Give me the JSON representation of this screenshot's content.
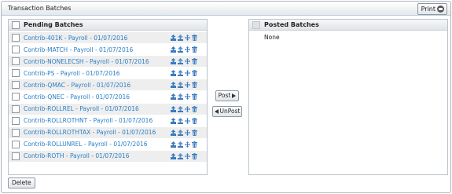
{
  "window": {
    "title": "Transaction Batches",
    "print_label": "Print"
  },
  "pending": {
    "header": "Pending Batches",
    "items": [
      "Contrib-401K - Payroll - 01/07/2016",
      "Contrib-MATCH - Payroll - 01/07/2016",
      "Contrib-NONELECSH - Payroll - 01/07/2016",
      "Contrib-PS - Payroll - 01/07/2016",
      "Contrib-QMAC - Payroll - 01/07/2016",
      "Contrib-QNEC - Payroll - 01/07/2016",
      "Contrib-ROLLREL - Payroll - 01/07/2016",
      "Contrib-ROLLROTHNT - Payroll - 01/07/2016",
      "Contrib-ROLLROTHTAX - Payroll - 01/07/2016",
      "Contrib-ROLLUNREL - Payroll - 01/07/2016",
      "Contrib-ROTH - Payroll - 01/07/2016"
    ],
    "row_icons": [
      "export-icon",
      "upload-icon",
      "move-icon",
      "trash-icon"
    ]
  },
  "actions": {
    "post_label": "Post",
    "unpost_label": "UnPost"
  },
  "posted": {
    "header": "Posted Batches",
    "empty_text": "None"
  },
  "footer": {
    "delete_label": "Delete"
  },
  "colors": {
    "link": "#2a7fc6",
    "icon": "#3b7bbf"
  }
}
